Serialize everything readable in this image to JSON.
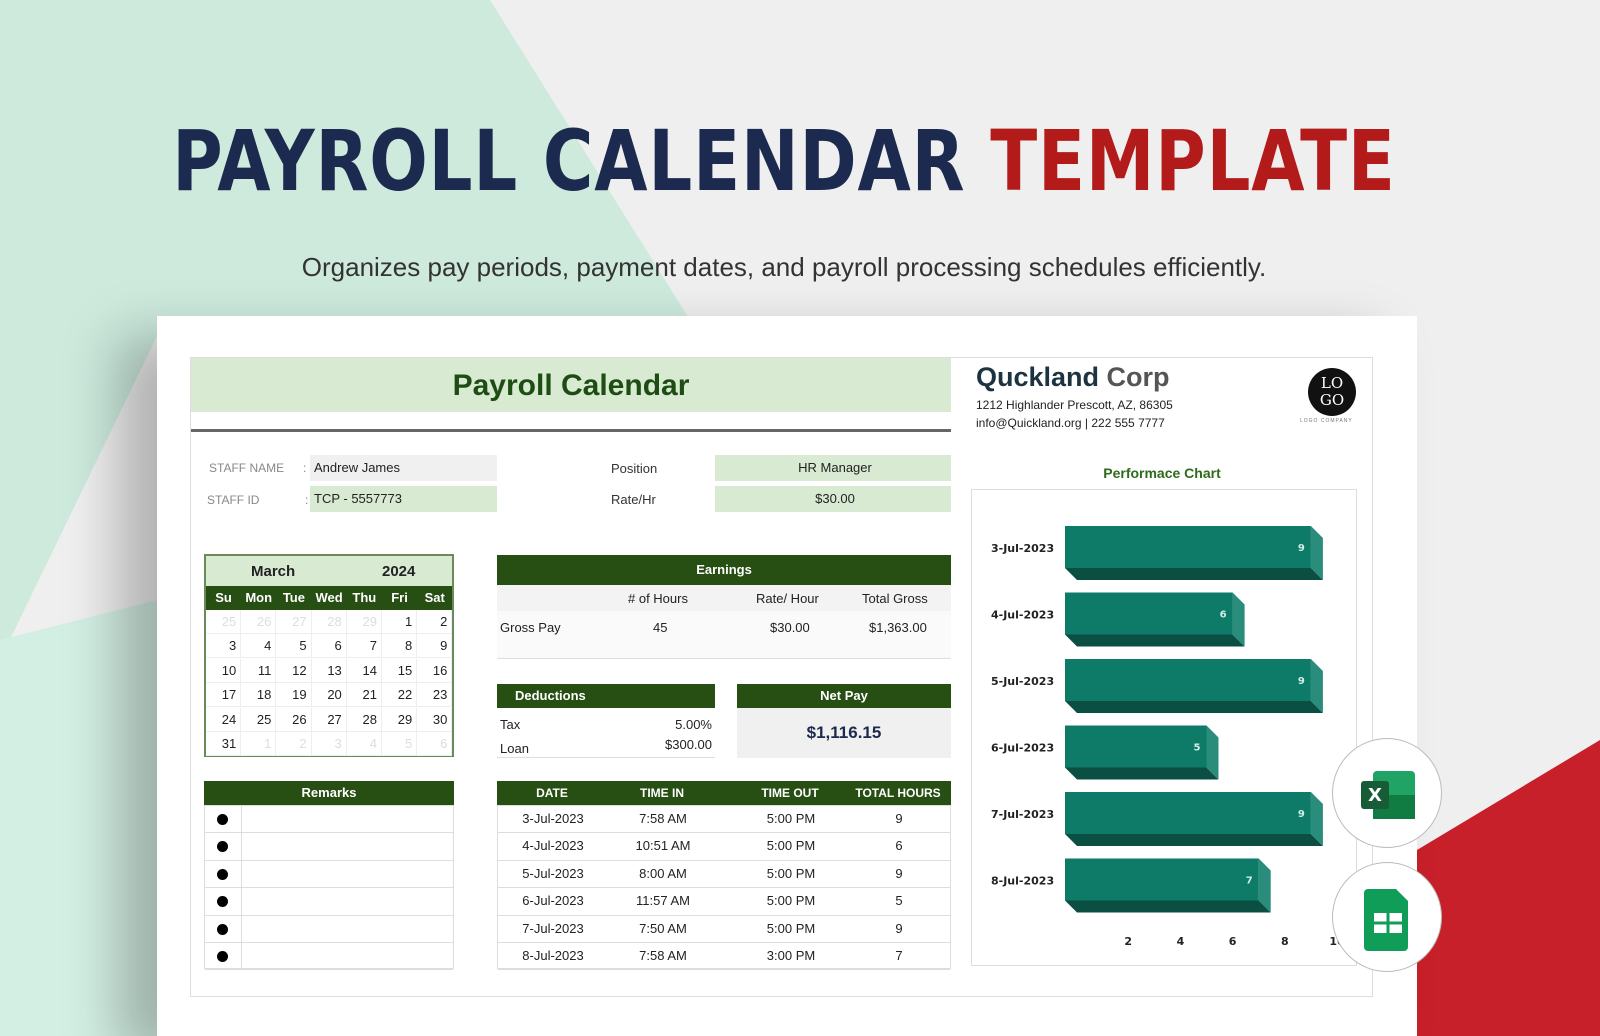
{
  "banner": {
    "title_part1": "PAYROLL CALENDAR",
    "title_part2": "TEMPLATE",
    "subtitle": "Organizes pay periods, payment dates, and payroll processing schedules efficiently."
  },
  "colors": {
    "navy": "#1c2a4f",
    "red": "#b31b1b",
    "dark_green": "#274e13",
    "light_green": "#d9ead3",
    "teal": "#0e7a68"
  },
  "sheet": {
    "title": "Payroll Calendar",
    "staff": {
      "name_label": "STAFF NAME",
      "name": "Andrew James",
      "id_label": "STAFF ID",
      "id": "TCP - 5557773",
      "position_label": "Position",
      "position": "HR Manager",
      "rate_label": "Rate/Hr",
      "rate": "$30.00",
      "sep": ":"
    },
    "calendar": {
      "month": "March",
      "year": "2024",
      "weekdays": [
        "Su",
        "Mon",
        "Tue",
        "Wed",
        "Thu",
        "Fri",
        "Sat"
      ],
      "days": [
        [
          "25",
          "26",
          "27",
          "28",
          "29",
          "1",
          "2"
        ],
        [
          "3",
          "4",
          "5",
          "6",
          "7",
          "8",
          "9"
        ],
        [
          "10",
          "11",
          "12",
          "13",
          "14",
          "15",
          "16"
        ],
        [
          "17",
          "18",
          "19",
          "20",
          "21",
          "22",
          "23"
        ],
        [
          "24",
          "25",
          "26",
          "27",
          "28",
          "29",
          "30"
        ],
        [
          "31",
          "1",
          "2",
          "3",
          "4",
          "5",
          "6"
        ]
      ]
    },
    "earnings": {
      "title": "Earnings",
      "headers": [
        "# of Hours",
        "Rate/ Hour",
        "Total Gross"
      ],
      "row_label": "Gross Pay",
      "hours": "45",
      "rate": "$30.00",
      "total": "$1,363.00"
    },
    "deductions": {
      "title": "Deductions",
      "items": [
        {
          "label": "Tax",
          "value": "5.00%"
        },
        {
          "label": "Loan",
          "value": "$300.00"
        }
      ]
    },
    "net_pay": {
      "title": "Net Pay",
      "value": "$1,116.15"
    },
    "remarks": {
      "title": "Remarks",
      "count": 6
    },
    "timesheet": {
      "headers": [
        "DATE",
        "TIME IN",
        "TIME OUT",
        "TOTAL HOURS"
      ],
      "rows": [
        [
          "3-Jul-2023",
          "7:58 AM",
          "5:00 PM",
          "9"
        ],
        [
          "4-Jul-2023",
          "10:51 AM",
          "5:00 PM",
          "6"
        ],
        [
          "5-Jul-2023",
          "8:00 AM",
          "5:00 PM",
          "9"
        ],
        [
          "6-Jul-2023",
          "11:57 AM",
          "5:00 PM",
          "5"
        ],
        [
          "7-Jul-2023",
          "7:50 AM",
          "5:00 PM",
          "9"
        ],
        [
          "8-Jul-2023",
          "7:58 AM",
          "3:00 PM",
          "7"
        ]
      ]
    },
    "company": {
      "name_part1": "Quckland",
      "name_part2": "Corp",
      "address": "1212 Highlander Prescott, AZ, 86305",
      "contact": "info@Quickland.org | 222 555 7777",
      "logo_text": "LO GO",
      "logo_caption": "LOGO COMPANY"
    }
  },
  "chart_data": {
    "type": "bar",
    "orientation": "horizontal",
    "title": "Performace Chart",
    "categories": [
      "3-Jul-2023",
      "4-Jul-2023",
      "5-Jul-2023",
      "6-Jul-2023",
      "7-Jul-2023",
      "8-Jul-2023"
    ],
    "values": [
      9,
      6,
      9,
      5,
      9,
      7
    ],
    "x_ticks": [
      "2",
      "4",
      "6",
      "8",
      "10"
    ],
    "xlim": [
      0,
      10
    ],
    "data_labels": true,
    "grid": false
  },
  "icons": [
    "excel-icon",
    "google-sheets-icon"
  ]
}
